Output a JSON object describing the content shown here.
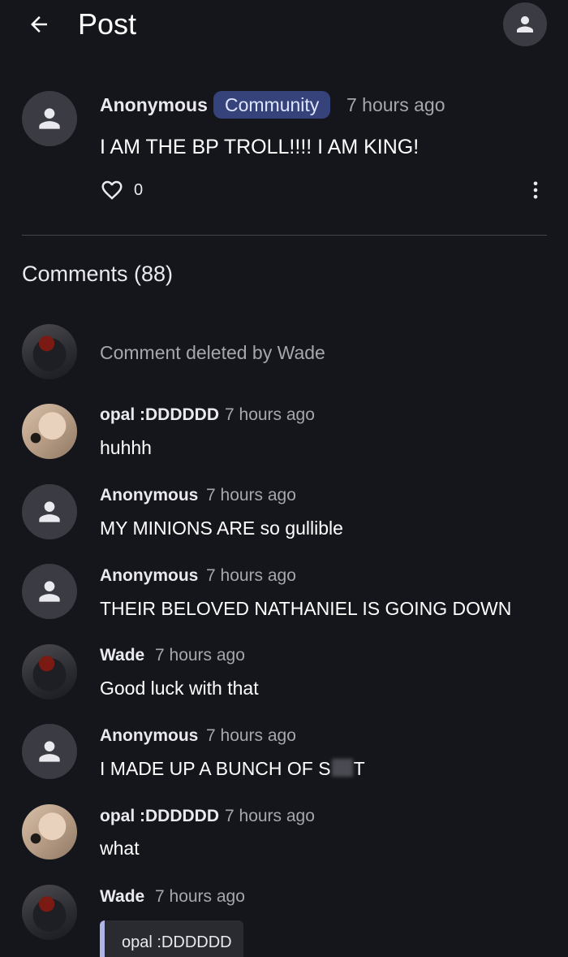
{
  "header": {
    "title": "Post"
  },
  "post": {
    "author": "Anonymous",
    "badge": "Community",
    "time": "7 hours ago",
    "text": "I AM THE BP TROLL!!!! I AM KING!",
    "like_count": "0"
  },
  "comments_heading": "Comments (88)",
  "comments": [
    {
      "deleted_text": "Comment deleted by Wade"
    },
    {
      "author": "opal :DDDDDD",
      "time": "7 hours ago",
      "text": "huhhh"
    },
    {
      "author": "Anonymous",
      "time": "7 hours ago",
      "text": "MY MINIONS ARE so gullible"
    },
    {
      "author": "Anonymous",
      "time": "7 hours ago",
      "text": "THEIR BELOVED NATHANIEL IS GOING DOWN"
    },
    {
      "author": "Wade",
      "time": "7 hours ago",
      "text": "Good luck with that"
    },
    {
      "author": "Anonymous",
      "time": "7 hours ago",
      "text_prefix": "I MADE UP A BUNCH OF S",
      "text_suffix": "T"
    },
    {
      "author": "opal :DDDDDD",
      "time": "7 hours ago",
      "text": "what"
    },
    {
      "author": "Wade",
      "time": "7 hours ago",
      "quote_author": "opal :DDDDDD"
    }
  ],
  "icons": {
    "back": "arrow-left-icon",
    "profile": "person-icon",
    "like": "heart-outline-icon",
    "more": "more-vertical-icon",
    "default_avatar": "person-icon"
  },
  "colors": {
    "background": "#15161c",
    "avatar_bg": "#3b3c43",
    "badge_bg": "#36427a",
    "muted_text": "#a6a7ad",
    "quote_bar": "#aeb6e8"
  }
}
